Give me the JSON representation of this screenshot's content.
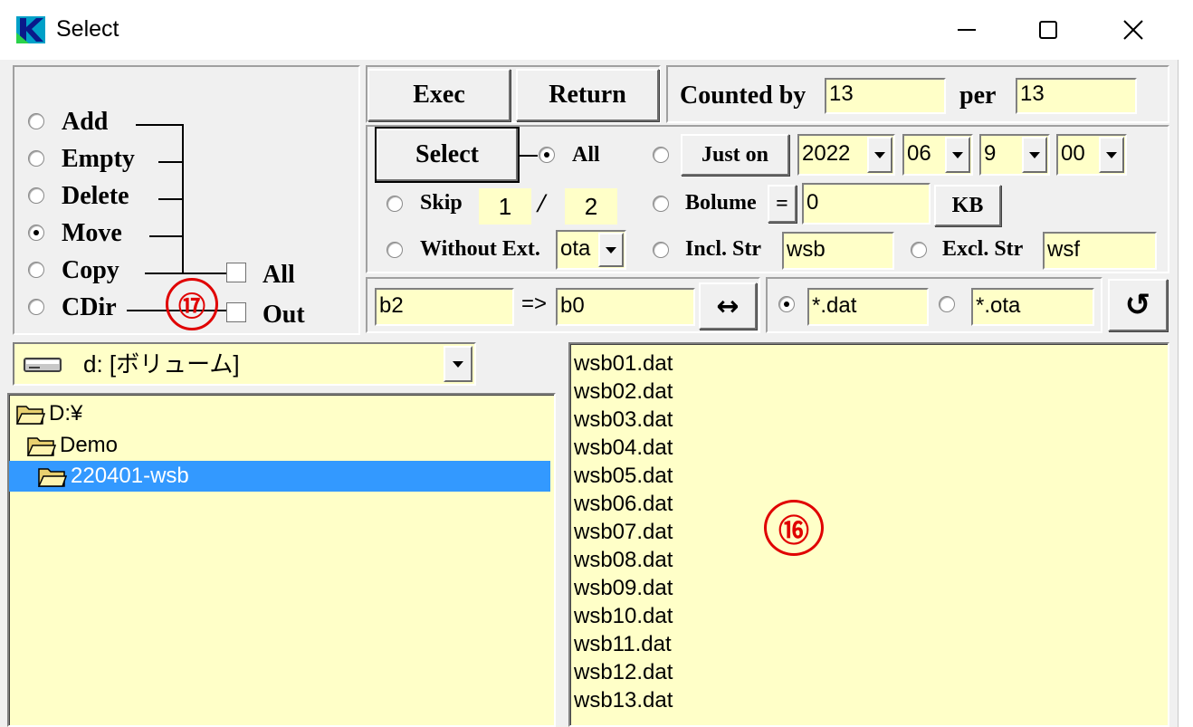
{
  "window": {
    "title": "Select",
    "controls": [
      "minimize",
      "maximize",
      "close"
    ]
  },
  "mode_panel": {
    "options": [
      {
        "label": "Add",
        "selected": false
      },
      {
        "label": "Empty",
        "selected": false
      },
      {
        "label": "Delete",
        "selected": false
      },
      {
        "label": "Move",
        "selected": true
      },
      {
        "label": "Copy",
        "selected": false
      },
      {
        "label": "CDir",
        "selected": false
      }
    ],
    "checkboxes": [
      {
        "label": "All",
        "checked": false
      },
      {
        "label": "Out",
        "checked": false
      }
    ],
    "callout": "⑰"
  },
  "toolbar": {
    "exec_label": "Exec",
    "return_label": "Return",
    "counted_by_label": "Counted by",
    "counted_by_value": "13",
    "per_label": "per",
    "per_value": "13"
  },
  "selection": {
    "select_label": "Select",
    "all_label": "All",
    "skip_label": "Skip",
    "skip_value": "1",
    "skip_separator": "/",
    "skip_total": "2",
    "without_ext_label": "Without Ext.",
    "without_ext_value": "ota",
    "just_on_label": "Just on",
    "year": "2022",
    "month": "06",
    "day": "9",
    "hour": "00",
    "bolume_label": "Bolume",
    "bolume_op": "=",
    "bolume_value": "0",
    "kb_label": "KB",
    "incl_label": "Incl. Str",
    "incl_value": "wsb",
    "excl_label": "Excl. Str",
    "excl_value": "wsf"
  },
  "rename": {
    "from_value": "b2",
    "arrow": "=>",
    "to_value": "b0",
    "swap_glyph": "↔",
    "pattern1": "*.dat",
    "pattern2": "*.ota",
    "refresh_glyph": "↺"
  },
  "drive": {
    "label": "d: [ボリューム]"
  },
  "tree": [
    {
      "label": "D:¥",
      "indent": 0,
      "selected": false
    },
    {
      "label": "Demo",
      "indent": 1,
      "selected": false
    },
    {
      "label": "220401-wsb",
      "indent": 2,
      "selected": true
    }
  ],
  "files": [
    "wsb01.dat",
    "wsb02.dat",
    "wsb03.dat",
    "wsb04.dat",
    "wsb05.dat",
    "wsb06.dat",
    "wsb07.dat",
    "wsb08.dat",
    "wsb09.dat",
    "wsb10.dat",
    "wsb11.dat",
    "wsb12.dat",
    "wsb13.dat"
  ],
  "file_callout": "⑯",
  "colors": {
    "field_bg": "#ffffc8",
    "selection_bg": "#3399ff",
    "callout": "#e00000",
    "window_bg": "#f0f0f0"
  }
}
